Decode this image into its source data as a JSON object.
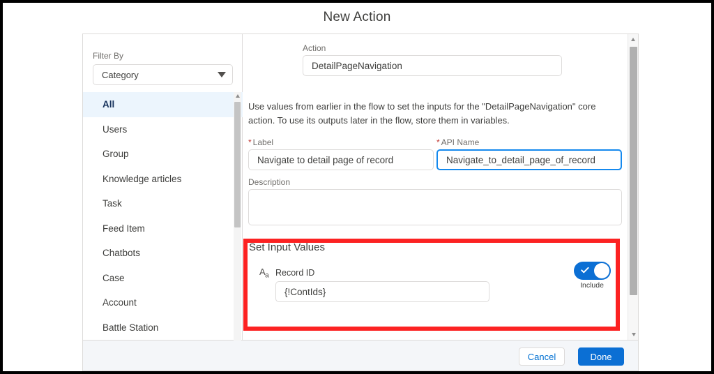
{
  "modal": {
    "title": "New Action"
  },
  "sidebar": {
    "filter_label": "Filter By",
    "filter_value": "Category",
    "filter_icon": "chevron-down-icon",
    "categories": [
      {
        "label": "All",
        "selected": true
      },
      {
        "label": "Users",
        "selected": false
      },
      {
        "label": "Group",
        "selected": false
      },
      {
        "label": "Knowledge articles",
        "selected": false
      },
      {
        "label": "Task",
        "selected": false
      },
      {
        "label": "Feed Item",
        "selected": false
      },
      {
        "label": "Chatbots",
        "selected": false
      },
      {
        "label": "Case",
        "selected": false
      },
      {
        "label": "Account",
        "selected": false
      },
      {
        "label": "Battle Station",
        "selected": false
      }
    ]
  },
  "main": {
    "action": {
      "label": "Action",
      "value": "DetailPageNavigation"
    },
    "intro_text": "Use values from earlier in the flow to set the inputs for the \"DetailPageNavigation\" core action. To use its outputs later in the flow, store them in variables.",
    "label_field": {
      "required_marker": "*",
      "label": "Label",
      "value": "Navigate to detail page of record"
    },
    "api_name_field": {
      "required_marker": "*",
      "label": "API Name",
      "value": "Navigate_to_detail_page_of_record"
    },
    "description_field": {
      "label": "Description",
      "value": "",
      "placeholder": ""
    },
    "set_input_values": {
      "title": "Set Input Values",
      "type_icon": "text-data-type-icon",
      "type_icon_main": "A",
      "type_icon_sub": "a",
      "record_id": {
        "label": "Record ID",
        "value": "{!ContIds}"
      },
      "toggle": {
        "caption": "Include",
        "state": "on",
        "icon": "check-icon"
      }
    }
  },
  "footer": {
    "cancel_label": "Cancel",
    "done_label": "Done"
  },
  "annotation": {
    "highlight_color": "#fc2222"
  },
  "scrollbars": {
    "up_arrow_icon": "triangle-up-icon",
    "down_arrow_icon": "triangle-down-icon"
  },
  "colors": {
    "accent_blue": "#0b6fd4",
    "link_blue": "#0070d2",
    "selected_row_bg": "#ecf5fd",
    "required_red": "#c23934",
    "highlight_red": "#fc2222"
  }
}
